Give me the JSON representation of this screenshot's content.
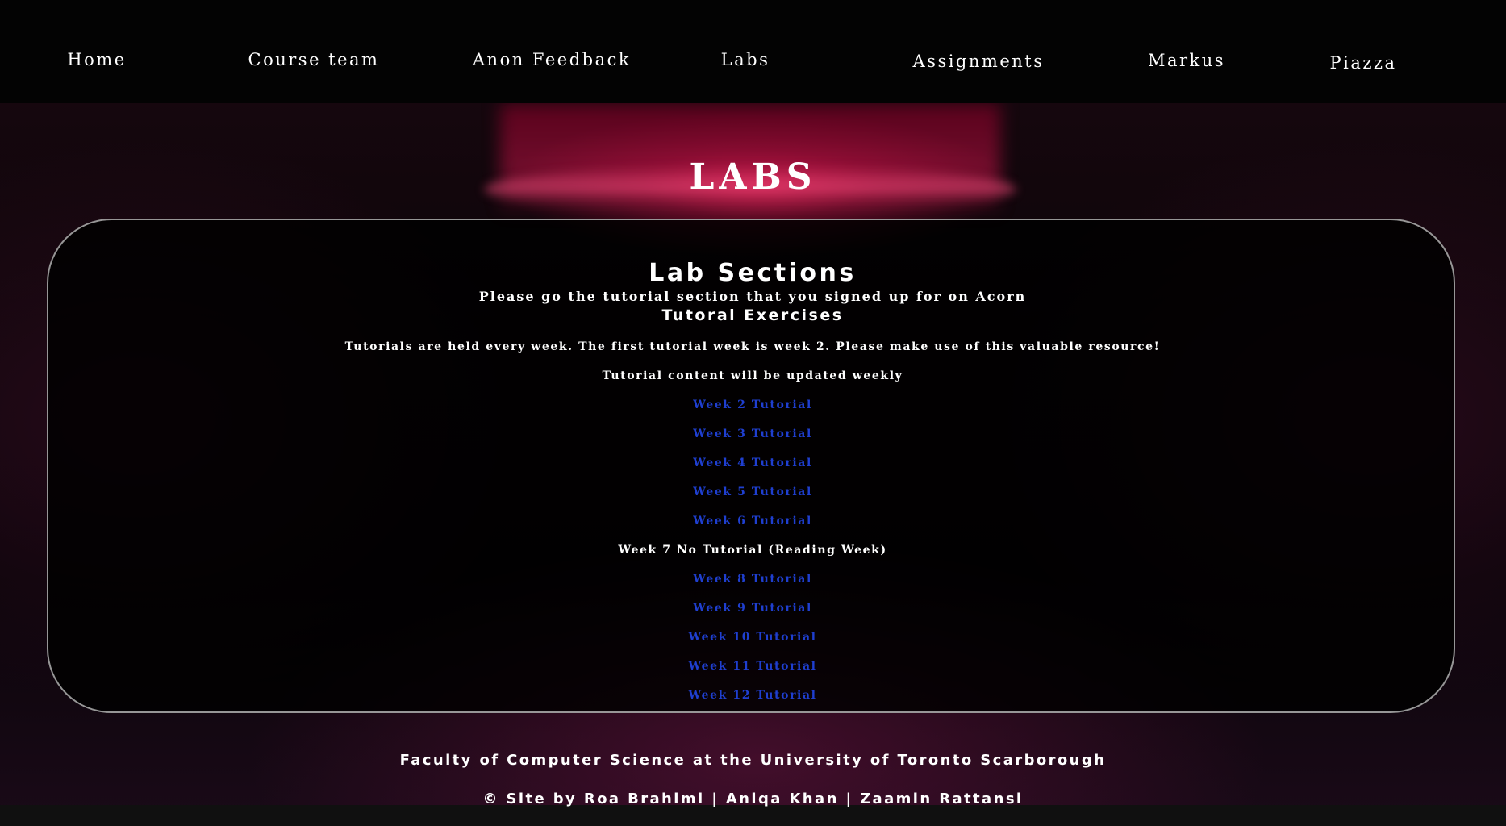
{
  "nav": {
    "items": [
      {
        "label": "Home"
      },
      {
        "label": "Course team"
      },
      {
        "label": "Anon Feedback"
      },
      {
        "label": "Labs"
      },
      {
        "label": "Assignments"
      },
      {
        "label": "Markus"
      },
      {
        "label": "Piazza"
      }
    ]
  },
  "page": {
    "title": "LABS"
  },
  "card": {
    "heading": "Lab Sections",
    "subheading": "Please go the tutorial section that you signed up for on Acorn",
    "exercises_heading": "Tutoral Exercises",
    "intro": "Tutorials are held every week. The first tutorial week is week 2. Please make use of this valuable resource!",
    "update_note": "Tutorial content will be updated weekly",
    "weeks": [
      {
        "label": "Week 2 Tutorial",
        "link": true
      },
      {
        "label": "Week 3 Tutorial",
        "link": true
      },
      {
        "label": "Week 4 Tutorial",
        "link": true
      },
      {
        "label": "Week 5 Tutorial",
        "link": true
      },
      {
        "label": "Week 6 Tutorial",
        "link": true
      },
      {
        "label": "Week 7 No Tutorial (Reading Week)",
        "link": false
      },
      {
        "label": "Week 8 Tutorial",
        "link": true
      },
      {
        "label": "Week 9 Tutorial",
        "link": true
      },
      {
        "label": "Week 10 Tutorial",
        "link": true
      },
      {
        "label": "Week 11 Tutorial",
        "link": true
      },
      {
        "label": "Week 12 Tutorial",
        "link": true
      }
    ]
  },
  "footer": {
    "faculty": "Faculty of Computer Science at the University of Toronto Scarborough",
    "credits": "© Site by Roa Brahimi | Aniqa Khan | Zaamin Rattansi"
  },
  "colors": {
    "link": "#1f3fd0",
    "nav_background": "#030303",
    "accent_glow": "#d21e50"
  }
}
